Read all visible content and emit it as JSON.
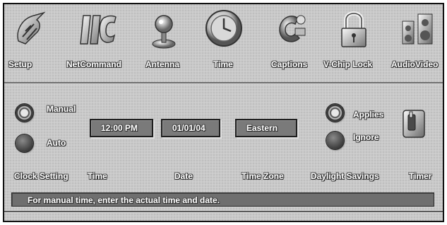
{
  "menu": {
    "items": [
      {
        "label": "Setup",
        "icon": "setup-icon"
      },
      {
        "label": "NetCommand",
        "icon": "netcommand-icon"
      },
      {
        "label": "Antenna",
        "icon": "antenna-icon"
      },
      {
        "label": "Time",
        "icon": "clock-icon"
      },
      {
        "label": "Captions",
        "icon": "captions-icon"
      },
      {
        "label": "V-Chip Lock",
        "icon": "lock-icon"
      },
      {
        "label": "AudioVideo",
        "icon": "audio-video-icon"
      }
    ],
    "selected": "Time"
  },
  "clock_setting": {
    "label": "Clock Setting",
    "options": [
      {
        "label": "Manual",
        "selected": true
      },
      {
        "label": "Auto",
        "selected": false
      }
    ]
  },
  "time_field": {
    "label": "Time",
    "value": "12:00 PM"
  },
  "date_field": {
    "label": "Date",
    "value": "01/01/04"
  },
  "timezone_field": {
    "label": "Time Zone",
    "value": "Eastern"
  },
  "daylight_savings": {
    "label": "Daylight Savings",
    "options": [
      {
        "label": "Applies",
        "selected": true
      },
      {
        "label": "Ignore",
        "selected": false
      }
    ]
  },
  "timer": {
    "label": "Timer",
    "icon": "timer-icon"
  },
  "status_message": "For manual time, enter the actual time and date."
}
